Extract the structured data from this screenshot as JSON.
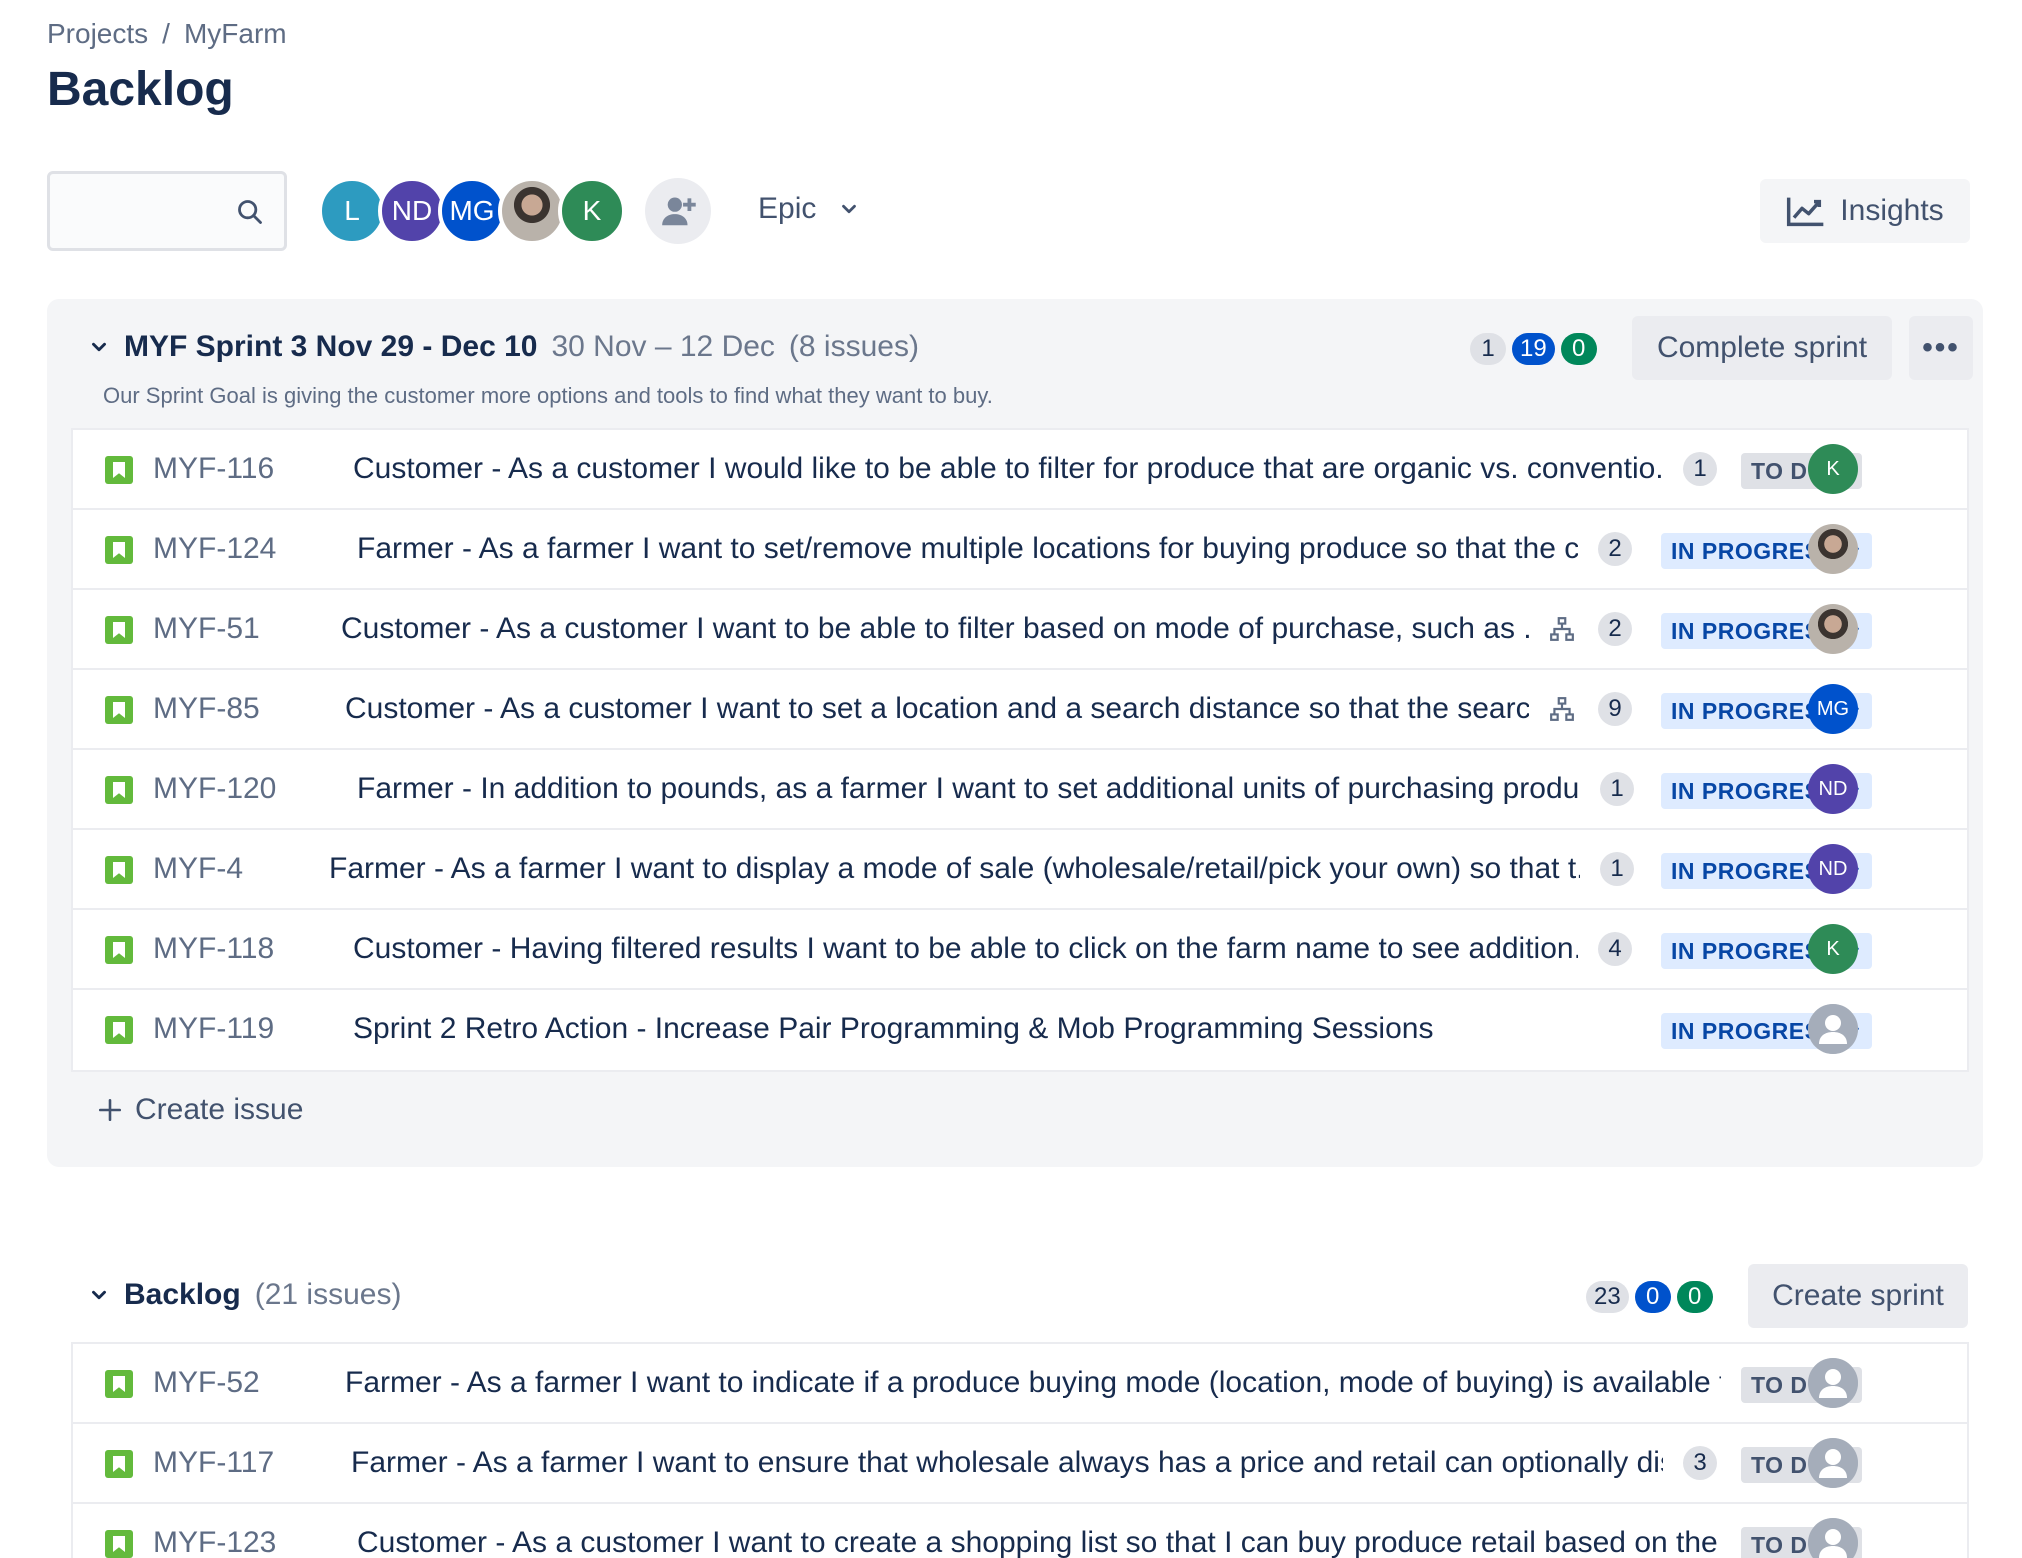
{
  "breadcrumb": {
    "projects": "Projects",
    "separator": "/",
    "project": "MyFarm"
  },
  "page_title": "Backlog",
  "search": {
    "placeholder": ""
  },
  "people": [
    {
      "initials": "L",
      "color": "#2d9bc0"
    },
    {
      "initials": "ND",
      "color": "#5243aa"
    },
    {
      "initials": "MG",
      "color": "#0052cc"
    },
    {
      "initials": "",
      "photo": true
    },
    {
      "initials": "K",
      "color": "#2e8b57"
    }
  ],
  "epic_filter": {
    "label": "Epic"
  },
  "insights": {
    "label": "Insights"
  },
  "sprint": {
    "name": "MYF Sprint 3 Nov 29 - Dec 10",
    "dates": "30 Nov – 12 Dec",
    "issue_count": "(8 issues)",
    "goal": "Our Sprint Goal is giving the customer more options and tools to find what they want to buy.",
    "counts": {
      "todo": "1",
      "in_progress": "19",
      "done": "0"
    },
    "complete_label": "Complete sprint",
    "more_label": "•••",
    "issues": [
      {
        "key": "MYF-116",
        "summary": "Customer - As a customer I would like to be able to filter for produce that are organic vs. conventio...",
        "child": false,
        "estimate": "1",
        "status": "TO DO",
        "assignee": "K",
        "assignee_color": "#2e8b57"
      },
      {
        "key": "MYF-124",
        "summary": "Farmer - As a farmer I want to set/remove multiple locations for buying produce so that the c...",
        "child": false,
        "estimate": "2",
        "status": "IN PROGRESS",
        "assignee": "",
        "assignee_photo": true
      },
      {
        "key": "MYF-51",
        "summary": "Customer - As a customer I want to be able to filter based on mode of purchase, such as ...",
        "child": true,
        "estimate": "2",
        "status": "IN PROGRESS",
        "assignee": "",
        "assignee_photo": true
      },
      {
        "key": "MYF-85",
        "summary": "Customer - As a customer I want to set a location and a search distance so that the searc...",
        "child": true,
        "estimate": "9",
        "status": "IN PROGRESS",
        "assignee": "MG",
        "assignee_color": "#0052cc"
      },
      {
        "key": "MYF-120",
        "summary": "Farmer - In addition to pounds, as a farmer I want to set additional units of purchasing produ...",
        "child": false,
        "estimate": "1",
        "status": "IN PROGRESS",
        "assignee": "ND",
        "assignee_color": "#5243aa"
      },
      {
        "key": "MYF-4",
        "summary": "Farmer - As a farmer I want to display a mode of sale (wholesale/retail/pick your own) so that t...",
        "child": false,
        "estimate": "1",
        "status": "IN PROGRESS",
        "assignee": "ND",
        "assignee_color": "#5243aa"
      },
      {
        "key": "MYF-118",
        "summary": "Customer - Having filtered results I want to be able to click on the farm name to see addition...",
        "child": false,
        "estimate": "4",
        "status": "IN PROGRESS",
        "assignee": "K",
        "assignee_color": "#2e8b57"
      },
      {
        "key": "MYF-119",
        "summary": "Sprint 2 Retro Action - Increase Pair Programming & Mob Programming Sessions",
        "child": false,
        "estimate": "",
        "status": "IN PROGRESS",
        "assignee": "",
        "unassigned": true
      }
    ]
  },
  "create_issue_label": "Create issue",
  "backlog": {
    "name": "Backlog",
    "issue_count": "(21 issues)",
    "counts": {
      "todo": "23",
      "in_progress": "0",
      "done": "0"
    },
    "create_sprint_label": "Create sprint",
    "issues": [
      {
        "key": "MYF-52",
        "summary": "Farmer - As a farmer I want to indicate if a produce buying mode (location, mode of buying) is available t...",
        "estimate": "",
        "status": "TO DO",
        "unassigned": true
      },
      {
        "key": "MYF-117",
        "summary": "Farmer - As a farmer I want to ensure that wholesale always has a price and retail can optionally dis...",
        "estimate": "3",
        "status": "TO DO",
        "unassigned": true
      },
      {
        "key": "MYF-123",
        "summary": "Customer - As a customer I want to create a shopping list so that I can buy produce retail based on the ...",
        "estimate": "",
        "status": "TO DO",
        "unassigned": true
      }
    ]
  }
}
